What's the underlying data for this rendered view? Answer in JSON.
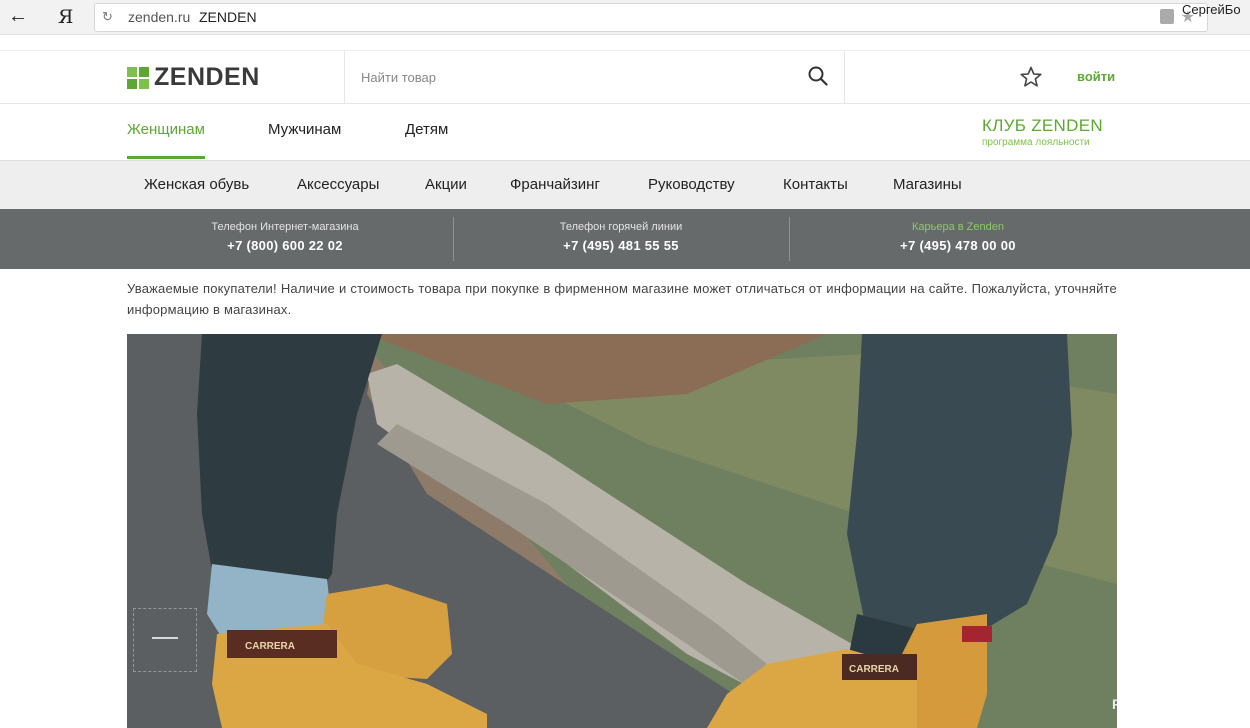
{
  "browser": {
    "back_label": "←",
    "ya_label": "Я",
    "domain": "zenden.ru",
    "title": "ZENDEN",
    "user": "СергейБо"
  },
  "header": {
    "logo_text": "ZENDEN",
    "search_placeholder": "Найти товар",
    "login_label": "войти"
  },
  "tabs": [
    {
      "label": "Женщинам",
      "active": true
    },
    {
      "label": "Мужчинам",
      "active": false
    },
    {
      "label": "Детям",
      "active": false
    }
  ],
  "club": {
    "title": "КЛУБ ZENDEN",
    "subtitle": "программа лояльности"
  },
  "menu": [
    {
      "label": "Женская обувь"
    },
    {
      "label": "Аксессуары"
    },
    {
      "label": "Акции"
    },
    {
      "label": "Франчайзинг"
    },
    {
      "label": "Руководству"
    },
    {
      "label": "Контакты"
    },
    {
      "label": "Магазины"
    }
  ],
  "phones": [
    {
      "label": "Телефон Интернет-магазина",
      "number": "+7 (800) 600 22 02"
    },
    {
      "label": "Телефон горячей линии",
      "number": "+7 (495) 481 55 55"
    },
    {
      "label": "Карьера в Zenden",
      "number": "+7 (495) 478 00 00"
    }
  ],
  "notice": "Уважаемые покупатели! Наличие и стоимость товара при покупке в фирменном магазине может отличаться от информации на сайте. Пожалуйста, уточняйте информацию в магазинах.",
  "banner": {
    "brand_text": "CARRERA"
  },
  "watermark": "RECOMMEND.RU",
  "colors": {
    "accent": "#5da832",
    "phone_bar": "#666a6b",
    "menu_bg": "#eeeeee"
  }
}
